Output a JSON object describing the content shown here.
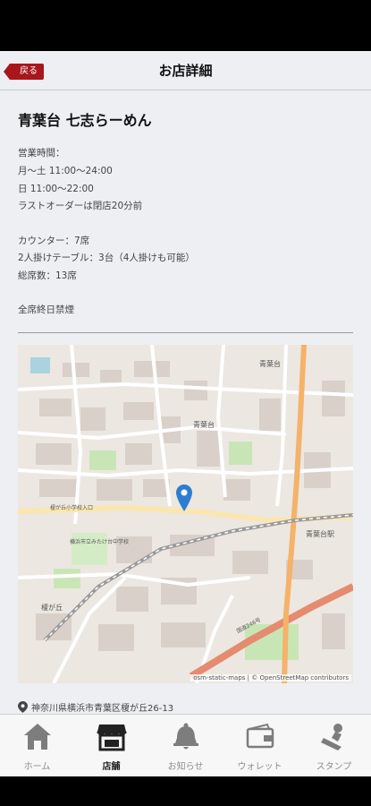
{
  "nav": {
    "back_label": "戻る",
    "title": "お店詳細"
  },
  "shop": {
    "name": "青葉台 七志らーめん",
    "hours_heading": "営業時間：",
    "hours_weekday": "月〜土 11:00〜24:00",
    "hours_sunday": "日 11:00〜22:00",
    "last_order": "ラストオーダーは閉店20分前",
    "seats_counter": "カウンター：7席",
    "seats_table": "2人掛けテーブル：3台（4人掛けも可能）",
    "seats_total": "総席数：13席",
    "smoking": "全席終日禁煙",
    "address": "神奈川県横浜市青葉区榎が丘26-13"
  },
  "map": {
    "credit": "osm-static-maps | © OpenStreetMap contributors",
    "labels": {
      "aobadai": "青葉台",
      "aobadai2": "青葉台",
      "aobadai_sta": "青葉台駅",
      "enokigaoka": "榎が丘",
      "school": "榎が丘小学校入口",
      "park": "横浜市立みたけ台中学校",
      "route": "国道246号"
    },
    "colors": {
      "marker": "#2e7dd1",
      "road_major": "#f4b26a",
      "railway": "#9a9a9a",
      "green": "#c8e6b5"
    }
  },
  "tabs": [
    {
      "label": "ホーム",
      "icon": "home-icon",
      "active": false
    },
    {
      "label": "店舗",
      "icon": "store-icon",
      "active": true
    },
    {
      "label": "お知らせ",
      "icon": "bell-icon",
      "active": false
    },
    {
      "label": "ウォレット",
      "icon": "wallet-icon",
      "active": false
    },
    {
      "label": "スタンプ",
      "icon": "stamp-icon",
      "active": false
    }
  ]
}
